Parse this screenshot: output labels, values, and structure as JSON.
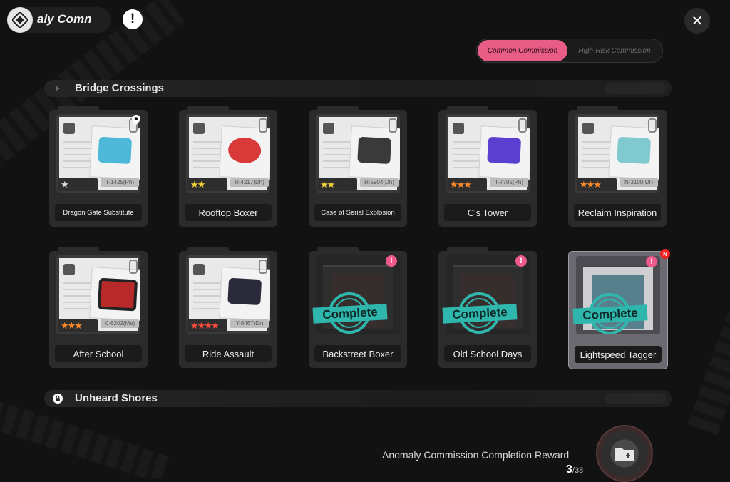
{
  "header": {
    "title": "aly Comn",
    "alert_icon": "alert-icon",
    "close_icon": "close-icon"
  },
  "tabs": {
    "common": "Common Commission",
    "high_risk": "High-Risk Commission",
    "active": "common"
  },
  "sections": [
    {
      "title": "Bridge Crossings",
      "locked": false
    },
    {
      "title": "Unheard Shores",
      "locked": true
    }
  ],
  "cards": [
    {
      "name": "Dragon Gate Substitute",
      "stars": 1,
      "code": "T-1425(Ph)",
      "pinned": true
    },
    {
      "name": "Rooftop Boxer",
      "stars": 2,
      "code": "R-4217(Dh)"
    },
    {
      "name": "Case of Serial Explosion",
      "stars": 2,
      "code": "R-5904(Dh)"
    },
    {
      "name": "C's Tower",
      "stars": 3,
      "code": "T-7705(Ph)"
    },
    {
      "name": "Reclaim Inspiration",
      "stars": 3,
      "code": "N-3100(Dr)"
    },
    {
      "name": "After School",
      "stars": 3,
      "code": "C-6202(Me)"
    },
    {
      "name": "Ride Assault",
      "stars": 4,
      "code": "Y-8467(Dr)"
    },
    {
      "name": "Backstreet Boxer",
      "status": "Complete"
    },
    {
      "name": "Old School Days",
      "status": "Complete"
    },
    {
      "name": "Lightspeed Tagger",
      "status": "Complete",
      "new_badge": "N"
    }
  ],
  "footer": {
    "reward_label": "Anomaly Commission Completion Reward",
    "progress_done": "3",
    "progress_total": "/38"
  },
  "colors": {
    "accent_pink": "#e85d86",
    "complete_teal": "#2fb6ad",
    "star_gold": "#f2d23a",
    "star_orange": "#ff8a2a",
    "star_red": "#ff4b3a"
  }
}
